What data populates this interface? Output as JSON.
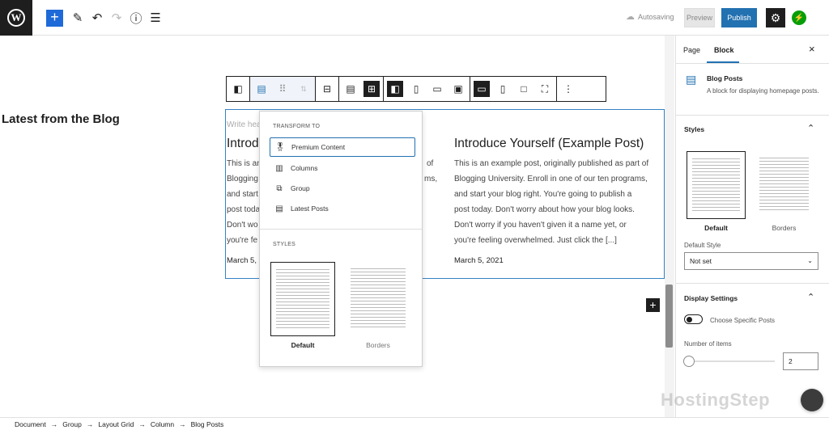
{
  "topbar": {
    "wp_logo": "W",
    "add_label": "+",
    "autosave_text": "Autosaving",
    "preview_label": "Preview",
    "publish_label": "Publish",
    "icons": [
      "pen-icon",
      "undo-icon",
      "redo-icon",
      "info-icon",
      "list-view-icon",
      "settings-icon",
      "jetpack-icon"
    ]
  },
  "canvas": {
    "section_heading": "Latest from the Blog",
    "posts": [
      {
        "placeholder": "Write hea",
        "title": "Introd",
        "lines": [
          "This is an",
          "Blogging",
          "and start",
          "post toda",
          "Don't wo",
          "you're fe"
        ],
        "line_tails": [
          "of",
          "ms,"
        ],
        "date": "March 5, 2"
      },
      {
        "title": "Introduce Yourself (Example Post)",
        "lines": [
          "This is an example post, originally published as part of",
          "Blogging University. Enroll in one of our ten programs,",
          "and start your blog right. You're going to publish a",
          "post today. Don't worry about how your blog looks.",
          "Don't worry if you haven't given it a name yet, or",
          "you're feeling overwhelmed. Just click the [...]"
        ],
        "date": "March 5, 2021"
      }
    ]
  },
  "transform_menu": {
    "heading": "TRANSFORM TO",
    "items": [
      "Premium Content",
      "Columns",
      "Group",
      "Latest Posts"
    ],
    "styles_heading": "STYLES",
    "styles": [
      "Default",
      "Borders"
    ]
  },
  "sidebar": {
    "tabs": [
      "Page",
      "Block"
    ],
    "close": "×",
    "block_name": "Blog Posts",
    "block_desc": "A block for displaying homepage posts.",
    "styles_title": "Styles",
    "styles": [
      "Default",
      "Borders"
    ],
    "default_style_label": "Default Style",
    "default_style_value": "Not set",
    "display_title": "Display Settings",
    "toggle_label": "Choose Specific Posts",
    "number_label": "Number of items",
    "number_value": "2"
  },
  "breadcrumb": [
    "Document",
    "Group",
    "Layout Grid",
    "Column",
    "Blog Posts"
  ],
  "breadcrumb_sep": "→",
  "watermark": "HostingStep",
  "colors": {
    "accent": "#2271b1",
    "dark": "#1e1e1e",
    "block_border": "#3582c4"
  }
}
